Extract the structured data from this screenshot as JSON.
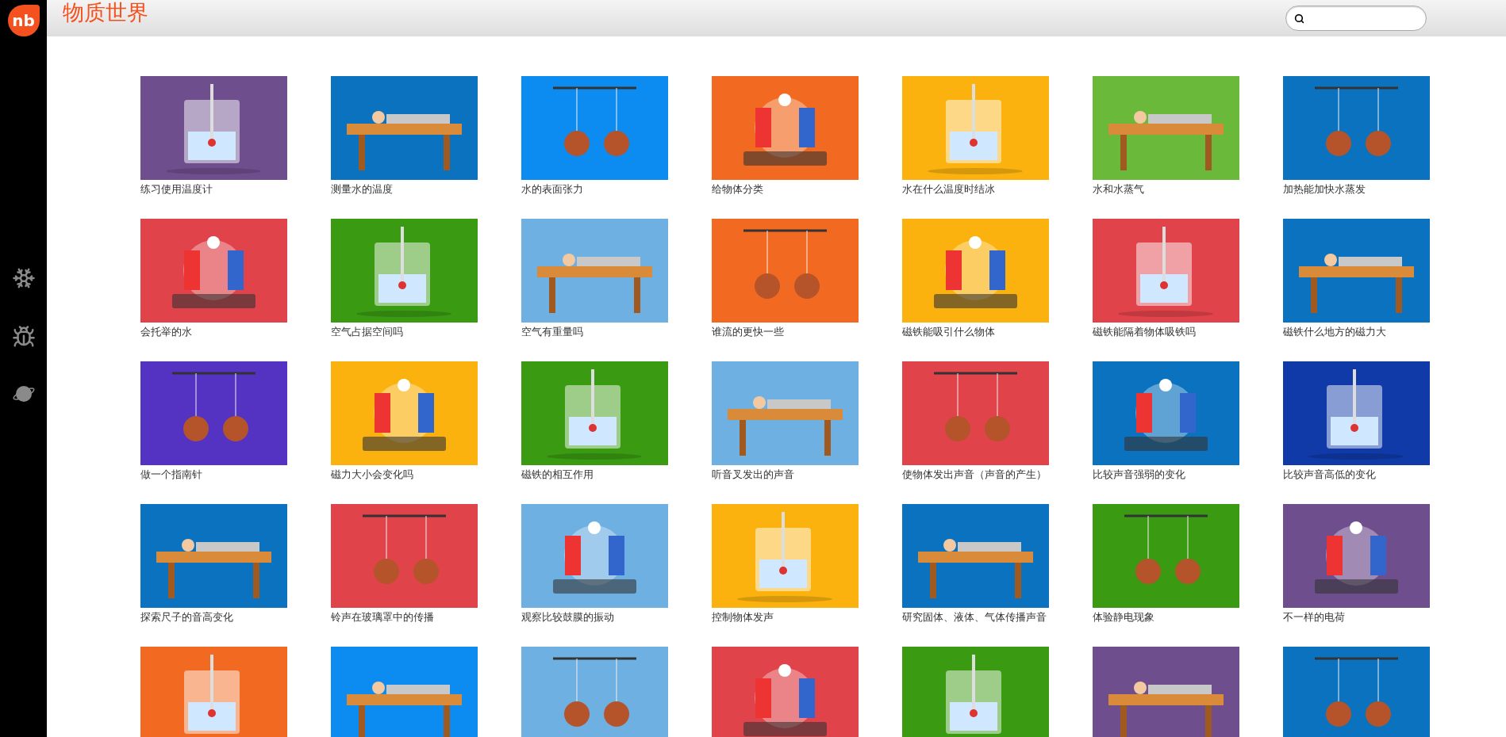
{
  "logo": {
    "text": "nb"
  },
  "header": {
    "title": "物质世界"
  },
  "sidebar": {
    "items": [
      {
        "kind": "snowflake"
      },
      {
        "kind": "bug"
      },
      {
        "kind": "planet"
      }
    ]
  },
  "tiles": [
    {
      "label": "练习使用温度计",
      "color": "#6f4e8e"
    },
    {
      "label": "测量水的温度",
      "color": "#0a72be"
    },
    {
      "label": "水的表面张力",
      "color": "#0c8cf0"
    },
    {
      "label": "给物体分类",
      "color": "#f26a21"
    },
    {
      "label": "水在什么温度时结冰",
      "color": "#fbb20f"
    },
    {
      "label": "水和水蒸气",
      "color": "#6ab93a"
    },
    {
      "label": "加热能加快水蒸发",
      "color": "#0a72be"
    },
    {
      "label": "会托举的水",
      "color": "#e1434b"
    },
    {
      "label": "空气占据空间吗",
      "color": "#3a9a12"
    },
    {
      "label": "空气有重量吗",
      "color": "#6fb0e3"
    },
    {
      "label": "谁流的更快一些",
      "color": "#f26a21"
    },
    {
      "label": "磁铁能吸引什么物体",
      "color": "#fbb20f"
    },
    {
      "label": "磁铁能隔着物体吸铁吗",
      "color": "#e1434b"
    },
    {
      "label": "磁铁什么地方的磁力大",
      "color": "#0a72be"
    },
    {
      "label": "做一个指南针",
      "color": "#5433c2"
    },
    {
      "label": "磁力大小会变化吗",
      "color": "#fbb20f"
    },
    {
      "label": "磁铁的相互作用",
      "color": "#3a9a12"
    },
    {
      "label": "听音叉发出的声音",
      "color": "#6fb0e3"
    },
    {
      "label": "使物体发出声音（声音的产生）",
      "color": "#e1434b"
    },
    {
      "label": "比较声音强弱的变化",
      "color": "#0a72be"
    },
    {
      "label": "比较声音高低的变化",
      "color": "#0f3aa8"
    },
    {
      "label": "探索尺子的音高变化",
      "color": "#0a72be"
    },
    {
      "label": "铃声在玻璃罩中的传播",
      "color": "#e1434b"
    },
    {
      "label": "观察比较鼓膜的振动",
      "color": "#6fb0e3"
    },
    {
      "label": "控制物体发声",
      "color": "#fbb20f"
    },
    {
      "label": "研究固体、液体、气体传播声音",
      "color": "#0a72be"
    },
    {
      "label": "体验静电现象",
      "color": "#3a9a12"
    },
    {
      "label": "不一样的电荷",
      "color": "#6f4e8e"
    },
    {
      "color": "#f26a21"
    },
    {
      "color": "#0c8cf0"
    },
    {
      "color": "#6fb0e3"
    },
    {
      "color": "#e1434b"
    },
    {
      "color": "#3a9a12"
    },
    {
      "color": "#6f4e8e"
    },
    {
      "color": "#0a72be"
    }
  ]
}
